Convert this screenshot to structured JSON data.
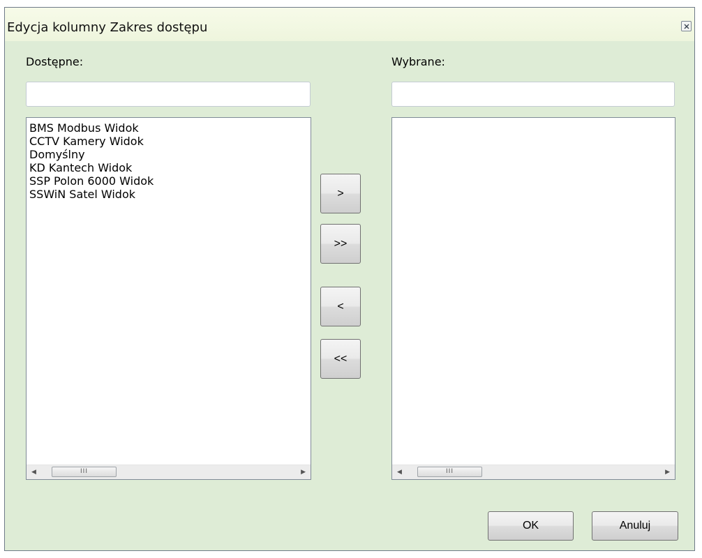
{
  "dialog": {
    "title": "Edycja kolumny Zakres dostępu",
    "available": {
      "label": "Dostępne:",
      "filter_value": "",
      "items": [
        "BMS Modbus Widok",
        "CCTV Kamery Widok",
        "Domyślny",
        "KD Kantech Widok",
        "SSP Polon 6000 Widok",
        "SSWiN Satel Widok"
      ]
    },
    "selected": {
      "label": "Wybrane:",
      "filter_value": "",
      "items": []
    },
    "move_buttons": {
      "add_one": ">",
      "add_all": ">>",
      "remove_one": "<",
      "remove_all": "<<"
    },
    "footer": {
      "ok_label": "OK",
      "cancel_label": "Anuluj"
    },
    "scroll_grip": "III"
  }
}
